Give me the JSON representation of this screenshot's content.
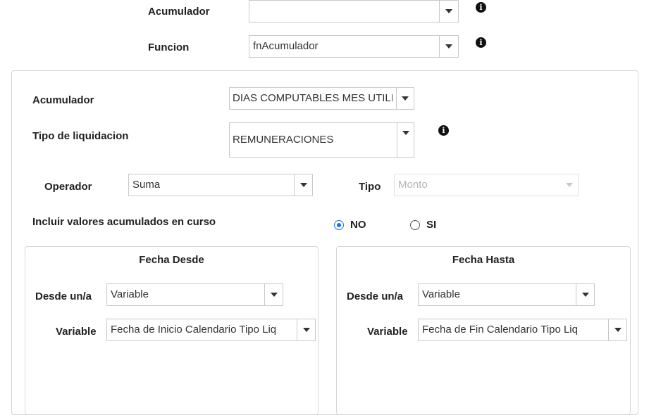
{
  "top": {
    "acumulador_label": "Acumulador",
    "acumulador_value": "",
    "funcion_label": "Funcion",
    "funcion_value": "fnAcumulador"
  },
  "panel": {
    "acumulador_label": "Acumulador",
    "acumulador_value": "DIAS COMPUTABLES MES UTILID",
    "tipo_liq_label": "Tipo de liquidacion",
    "tipo_liq_value": "REMUNERACIONES",
    "operador_label": "Operador",
    "operador_value": "Suma",
    "tipo_label": "Tipo",
    "tipo_value": "Monto",
    "incluir_label": "Incluir valores acumulados en curso",
    "incluir_options": [
      {
        "label": "NO",
        "selected": true
      },
      {
        "label": "SI",
        "selected": false
      }
    ]
  },
  "fecha_desde": {
    "title": "Fecha Desde",
    "desde_label": "Desde un/a",
    "desde_value": "Variable",
    "variable_label": "Variable",
    "variable_value": "Fecha de Inicio Calendario Tipo Liq"
  },
  "fecha_hasta": {
    "title": "Fecha Hasta",
    "desde_label": "Desde un/a",
    "desde_value": "Variable",
    "variable_label": "Variable",
    "variable_value": "Fecha de Fin Calendario Tipo Liq"
  },
  "icons": {
    "info": "i",
    "radio_accent": "#1a73e8"
  }
}
